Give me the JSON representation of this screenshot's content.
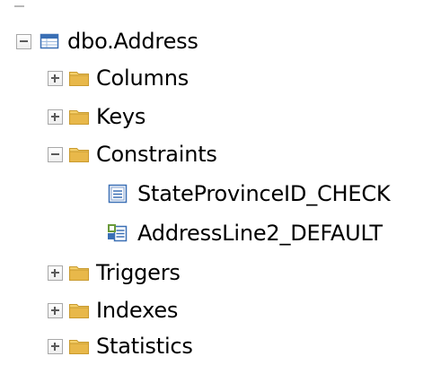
{
  "tree": {
    "table": {
      "label": "dbo.Address",
      "icon": "table-icon",
      "expanded": true
    },
    "folders": {
      "columns": {
        "label": "Columns",
        "icon": "folder-icon",
        "expanded": false
      },
      "keys": {
        "label": "Keys",
        "icon": "folder-icon",
        "expanded": false
      },
      "constraints": {
        "label": "Constraints",
        "icon": "folder-icon",
        "expanded": true,
        "children": [
          {
            "label": "StateProvinceID_CHECK",
            "icon": "check-constraint-icon"
          },
          {
            "label": "AddressLine2_DEFAULT",
            "icon": "default-constraint-icon"
          }
        ]
      },
      "triggers": {
        "label": "Triggers",
        "icon": "folder-icon",
        "expanded": false
      },
      "indexes": {
        "label": "Indexes",
        "icon": "folder-icon",
        "expanded": false
      },
      "statistics": {
        "label": "Statistics",
        "icon": "folder-icon",
        "expanded": false
      }
    }
  },
  "colors": {
    "folder": "#e8b84a",
    "table_blue": "#3a6fb5",
    "toggle_border": "#a8a8a8"
  }
}
